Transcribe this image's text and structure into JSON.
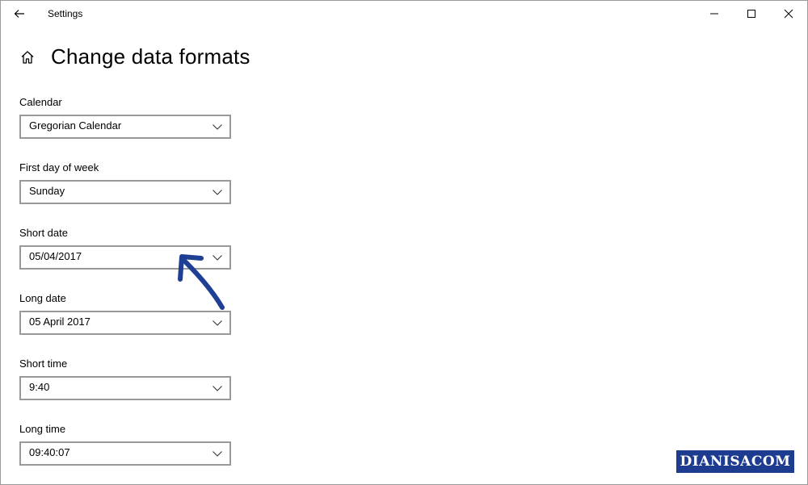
{
  "window": {
    "title": "Settings"
  },
  "page": {
    "title": "Change data formats"
  },
  "fields": [
    {
      "label": "Calendar",
      "value": "Gregorian Calendar"
    },
    {
      "label": "First day of week",
      "value": "Sunday"
    },
    {
      "label": "Short date",
      "value": "05/04/2017"
    },
    {
      "label": "Long date",
      "value": "05 April 2017"
    },
    {
      "label": "Short time",
      "value": "9:40"
    },
    {
      "label": "Long time",
      "value": "09:40:07"
    }
  ],
  "icons": {
    "back": "arrow-left-icon",
    "home": "home-icon",
    "minimize": "minimize-icon",
    "maximize": "maximize-icon",
    "close": "close-icon",
    "dropdown": "chevron-down-icon"
  },
  "annotation": {
    "color": "#1f3f95"
  },
  "watermark": {
    "text": "DIANISACOM",
    "background": "#1d3b8f"
  }
}
